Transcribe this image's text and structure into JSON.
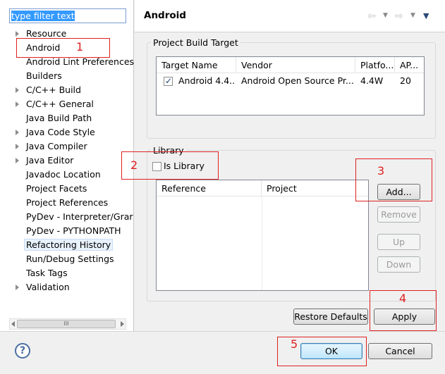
{
  "filter": {
    "text": "type filter text"
  },
  "tree": {
    "items": [
      {
        "label": "Resource",
        "expandable": true
      },
      {
        "label": "Android",
        "expandable": false,
        "selected": true
      },
      {
        "label": "Android Lint Preferences",
        "expandable": false
      },
      {
        "label": "Builders",
        "expandable": false
      },
      {
        "label": "C/C++ Build",
        "expandable": true
      },
      {
        "label": "C/C++ General",
        "expandable": true
      },
      {
        "label": "Java Build Path",
        "expandable": false
      },
      {
        "label": "Java Code Style",
        "expandable": true
      },
      {
        "label": "Java Compiler",
        "expandable": true
      },
      {
        "label": "Java Editor",
        "expandable": true
      },
      {
        "label": "Javadoc Location",
        "expandable": false
      },
      {
        "label": "Project Facets",
        "expandable": false
      },
      {
        "label": "Project References",
        "expandable": false
      },
      {
        "label": "PyDev - Interpreter/Grar",
        "expandable": false
      },
      {
        "label": "PyDev - PYTHONPATH",
        "expandable": false
      },
      {
        "label": "Refactoring History",
        "expandable": false,
        "highlighted": true
      },
      {
        "label": "Run/Debug Settings",
        "expandable": false
      },
      {
        "label": "Task Tags",
        "expandable": false
      },
      {
        "label": "Validation",
        "expandable": true
      }
    ],
    "scroll_grip": "III"
  },
  "header": {
    "title": "Android",
    "nav_icons": [
      "back-arrow-icon",
      "back-dropdown-icon",
      "forward-arrow-icon",
      "forward-dropdown-icon",
      "view-menu-icon"
    ]
  },
  "build_target": {
    "group_label": "Project Build Target",
    "columns": [
      "Target Name",
      "Vendor",
      "Platfo...",
      "AP..."
    ],
    "rows": [
      {
        "checked": true,
        "name": "Android 4.4....",
        "vendor": "Android Open Source Pr...",
        "platform": "4.4W",
        "api": "20"
      }
    ]
  },
  "library": {
    "group_label": "Library",
    "is_library_label": "Is Library",
    "is_library_checked": false,
    "columns": [
      "Reference",
      "Project"
    ],
    "buttons": {
      "add": "Add...",
      "remove": "Remove",
      "up": "Up",
      "down": "Down"
    }
  },
  "actions": {
    "restore_defaults": "Restore Defaults",
    "apply": "Apply"
  },
  "dialog": {
    "ok": "OK",
    "cancel": "Cancel",
    "help": "?"
  },
  "annotations": [
    "1",
    "2",
    "3",
    "4",
    "5"
  ],
  "colors": {
    "annotation_red": "#e02020",
    "selection_blue": "#3399ff"
  }
}
